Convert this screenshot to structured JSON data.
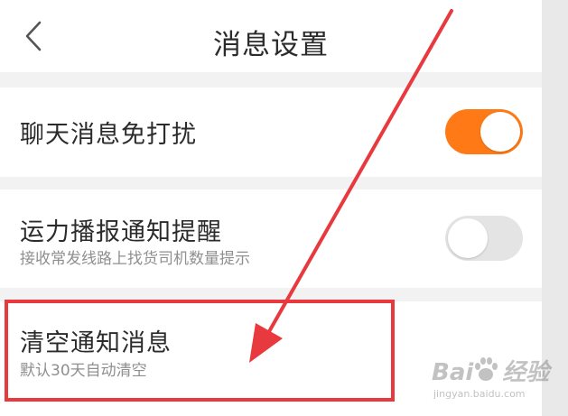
{
  "header": {
    "title": "消息设置",
    "back_icon": "chevron-left-icon"
  },
  "settings": {
    "dnd": {
      "title": "聊天消息免打扰",
      "enabled": true
    },
    "broadcast": {
      "title": "运力播报通知提醒",
      "subtitle": "接收常发线路上找货司机数量提示",
      "enabled": false
    },
    "clear": {
      "title": "清空通知消息",
      "subtitle": "默认30天自动清空"
    }
  },
  "watermark": {
    "brand_left": "Bai",
    "brand_right": "经验",
    "url": "jingyan.baidu.com"
  },
  "colors": {
    "accent": "#ff7a16",
    "toggle_off": "#e4e4e4",
    "annotation": "#e8393f"
  }
}
